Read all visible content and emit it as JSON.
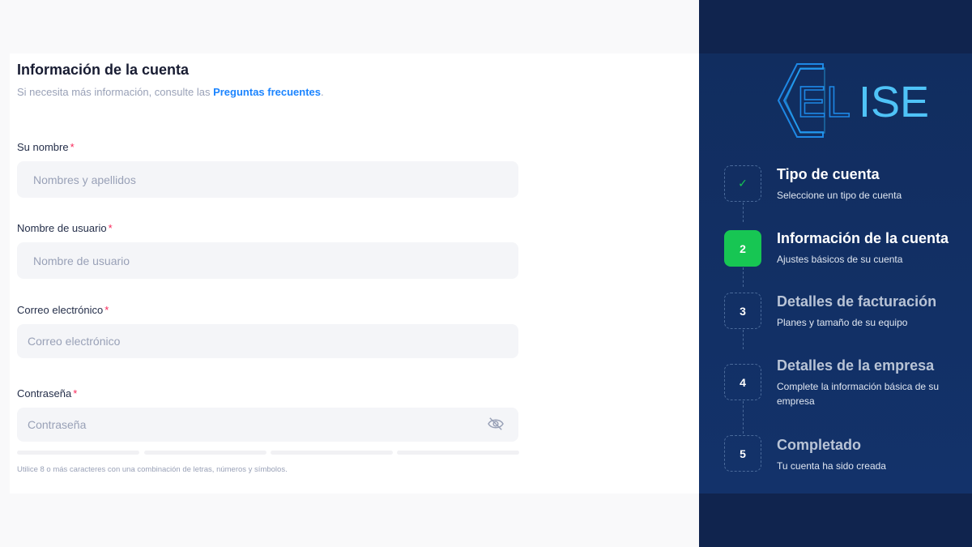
{
  "form": {
    "title": "Información de la cuenta",
    "subtitle": "Si necesita más información, consulte las",
    "faq_link": "Preguntas frecuentes",
    "subtitle_end": ".",
    "required_mark": "*",
    "fields": [
      {
        "label": "Su nombre",
        "placeholder": "Nombres y apellidos"
      },
      {
        "label": "Nombre de usuario",
        "placeholder": "Nombre de usuario"
      },
      {
        "label": "Correo electrónico",
        "placeholder": "Correo electrónico"
      },
      {
        "label": "Contraseña",
        "placeholder": "Contraseña"
      }
    ],
    "password_hint": "Utilice 8 o más caracteres con una combinación de letras, números y símbolos."
  },
  "aside": {
    "logo_text": "ELISE",
    "logo_colors": {
      "outline": "#1e88e5",
      "fill": "#29b6f6"
    },
    "steps": [
      {
        "number": "✓",
        "title": "Tipo de cuenta",
        "desc": "Seleccione un tipo de cuenta",
        "state": "completed"
      },
      {
        "number": "2",
        "title": "Información de la cuenta",
        "desc": "Ajustes básicos de su cuenta",
        "state": "current"
      },
      {
        "number": "3",
        "title": "Detalles de facturación",
        "desc": "Planes y tamaño de su equipo",
        "state": "pending"
      },
      {
        "number": "4",
        "title": "Detalles de la empresa",
        "desc": "Complete la información básica de su empresa",
        "state": "pending"
      },
      {
        "number": "5",
        "title": "Completado",
        "desc": "Tu cuenta ha sido creada",
        "state": "pending"
      }
    ]
  },
  "colors": {
    "accent": "#1b84ff",
    "success": "#17c653",
    "required": "#f8285a",
    "aside_bg": "#10244e"
  }
}
